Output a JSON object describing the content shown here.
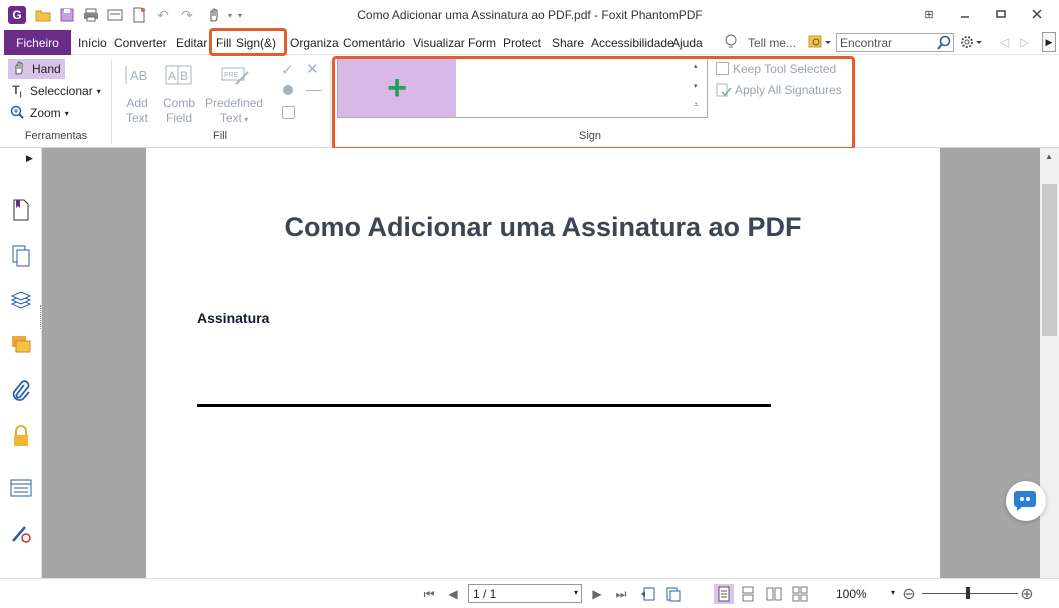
{
  "titlebar": {
    "app_logo": "G",
    "title": "Como Adicionar uma Assinatura ao PDF.pdf - Foxit PhantomPDF"
  },
  "menu": {
    "file": "Ficheiro",
    "items": [
      "Início",
      "Converter",
      "Editar"
    ],
    "fill": "Fill",
    "sign": "Sign(&)",
    "items_after": [
      "Organiza",
      "Comentário",
      "Visualizar",
      "Form",
      "Protect",
      "Share",
      "Accessibilidade",
      "Ajuda"
    ],
    "tell_me": "Tell me...",
    "search_placeholder": "Encontrar"
  },
  "ribbon": {
    "tools": {
      "hand": "Hand",
      "select": "Seleccionar",
      "zoom": "Zoom",
      "group_label": "Ferramentas"
    },
    "fill": {
      "add_text": [
        "Add",
        "Text"
      ],
      "comb_field": [
        "Comb",
        "Field"
      ],
      "predefined_text": [
        "Predefined",
        "Text"
      ],
      "group_label": "Fill"
    },
    "sign": {
      "group_label": "Sign",
      "keep_tool_selected": "Keep Tool Selected",
      "apply_all_signatures": "Apply All Signatures"
    }
  },
  "document": {
    "title": "Como Adicionar uma Assinatura ao PDF",
    "signature_label": "Assinatura"
  },
  "status": {
    "page": "1 / 1",
    "zoom": "100%"
  },
  "colors": {
    "brand": "#6b2c87",
    "highlight": "#e35c2d",
    "add_signature_bg": "#d7b8e6",
    "plus": "#21a35b"
  }
}
